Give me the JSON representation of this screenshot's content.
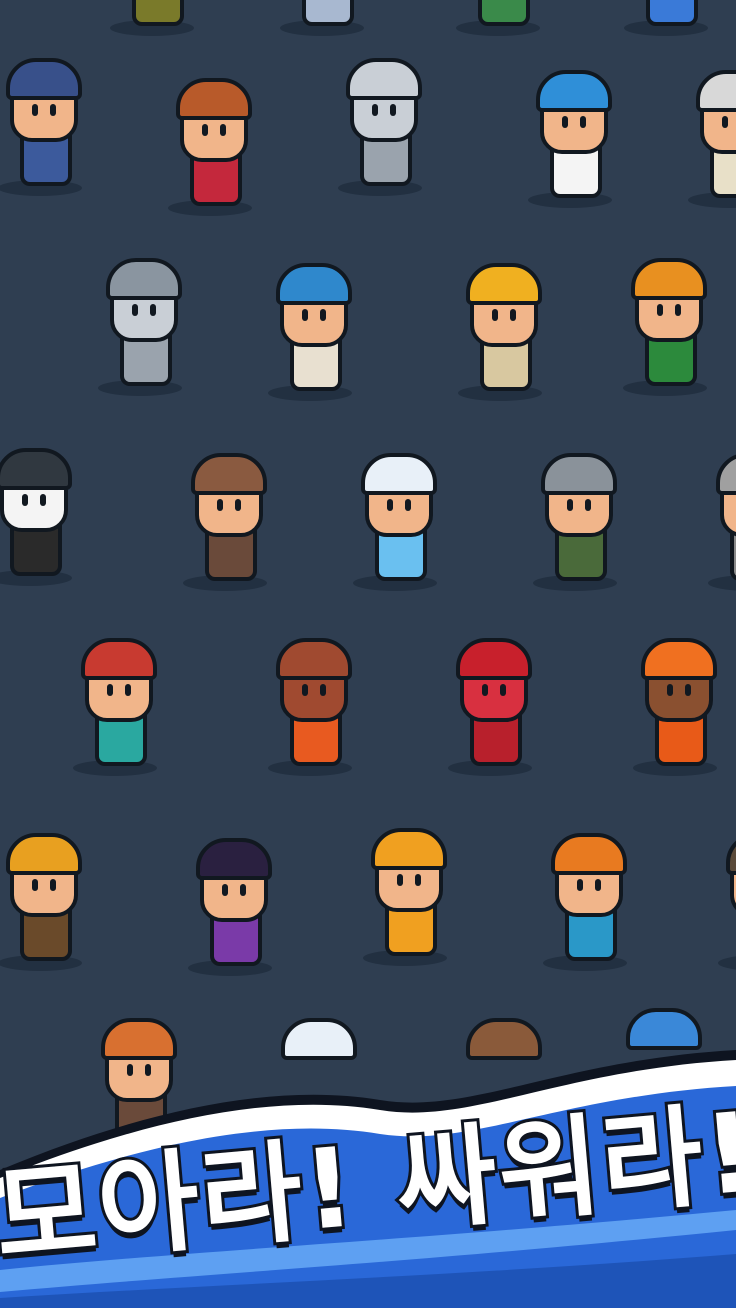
{
  "slogan": "모아라! 싸워라!",
  "colors": {
    "background": "#2f3e51",
    "banner_outer": "#ffffff",
    "banner_inner": "#2a68d8",
    "banner_stripe": "#5ea0f2",
    "text": "#ffffff",
    "outline": "#0e1420"
  },
  "heroes": [
    {
      "name": "hero-blue-mace-knight",
      "body": "#3c5a9c",
      "hat": "#38508a"
    },
    {
      "name": "hero-dancer",
      "body": "#c4283c",
      "hat": "#b85a2a"
    },
    {
      "name": "hero-armored-knight",
      "body": "#9aa3ad",
      "hat": "#c9cfd6"
    },
    {
      "name": "hero-nurse-priest",
      "body": "#f4f4f4",
      "hat": "#2f8fd8"
    },
    {
      "name": "hero-hammer-dwarf",
      "body": "#e8e0c8",
      "hat": "#d8d8d8"
    },
    {
      "name": "hero-shield-lancer",
      "body": "#9aa3ad",
      "hat": "#8a95a0"
    },
    {
      "name": "hero-musketeer",
      "body": "#e8e0d0",
      "hat": "#2f88cc"
    },
    {
      "name": "hero-turban-spearman",
      "body": "#d8c8a0",
      "hat": "#f0b020"
    },
    {
      "name": "hero-axe-woodsman",
      "body": "#2c8a3c",
      "hat": "#e89020"
    },
    {
      "name": "hero-top-hat-mage",
      "body": "#2a2a2a",
      "hat": "#303840"
    },
    {
      "name": "hero-cowboy-gunner",
      "body": "#6a4a3a",
      "hat": "#8a5a40"
    },
    {
      "name": "hero-ice-mage",
      "body": "#6ac0f0",
      "hat": "#e8f0f8"
    },
    {
      "name": "hero-viking-spearman",
      "body": "#4a6a3a",
      "hat": "#8a929a"
    },
    {
      "name": "hero-hooded-grey",
      "body": "#8a8a8a",
      "hat": "#a0a0a0"
    },
    {
      "name": "hero-goggle-crystal-miner",
      "body": "#2aa8a0",
      "hat": "#c83a30"
    },
    {
      "name": "hero-orange-monk",
      "body": "#e85a20",
      "hat": "#a04a30"
    },
    {
      "name": "hero-red-rabbit-mage",
      "body": "#b8202c",
      "hat": "#c8202c"
    },
    {
      "name": "hero-orange-hood-scout",
      "body": "#e85a18",
      "hat": "#f07020"
    },
    {
      "name": "hero-sword-bearer",
      "body": "#6a4a2a",
      "hat": "#e8a020"
    },
    {
      "name": "hero-serpent-witch",
      "body": "#7a3aa8",
      "hat": "#2a2040"
    },
    {
      "name": "hero-hourglass-girl",
      "body": "#f0a020",
      "hat": "#f0a020"
    },
    {
      "name": "hero-mermaid-trident",
      "body": "#2a98c8",
      "hat": "#e87a20"
    },
    {
      "name": "hero-horned-edge",
      "body": "#3a6a4a",
      "hat": "#5a4a3a"
    },
    {
      "name": "hero-shield-warrior",
      "body": "#6a4a3a",
      "hat": "#d87030"
    },
    {
      "name": "hero-snow-cap",
      "body": "#e8f0f8",
      "hat": "#e8f0f8"
    },
    {
      "name": "hero-brown-cap",
      "body": "#8a5a3a",
      "hat": "#8a5a3a"
    },
    {
      "name": "hero-blue-cone",
      "body": "#3a88d8",
      "hat": "#3a88d8"
    }
  ]
}
